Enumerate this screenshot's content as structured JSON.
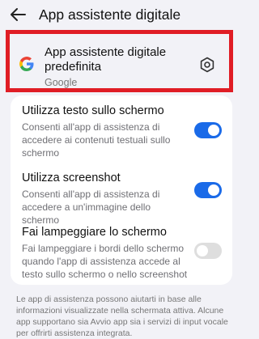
{
  "header": {
    "title": "App assistente digitale",
    "back_icon": "arrow-left-icon"
  },
  "default_app": {
    "title": "App assistente digitale predefinita",
    "subtitle": "Google",
    "logo_icon": "google-g-icon",
    "settings_icon": "gear-icon",
    "highlight_color": "#e01d25"
  },
  "settings": [
    {
      "title": "Utilizza testo sullo schermo",
      "description": "Consenti all'app di assistenza di accedere ai contenuti testuali sullo schermo",
      "enabled": true
    },
    {
      "title": "Utilizza screenshot",
      "description": "Consenti all'app di assistenza di accedere a un'immagine dello schermo",
      "enabled": true
    },
    {
      "title": "Fai lampeggiare lo schermo",
      "description": "Fai lampeggiare i bordi dello schermo quando l'app di assistenza accede al testo sullo schermo o nello screenshot",
      "enabled": false
    }
  ],
  "footer": {
    "text": "Le app di assistenza possono aiutarti in base alle informazioni visualizzate nella schermata attiva. Alcune app supportano sia Avvio app sia i servizi di input vocale per offrirti assistenza integrata."
  },
  "colors": {
    "toggle_on": "#1a6ae8",
    "toggle_off": "#dedede",
    "background": "#f2f2f7"
  }
}
